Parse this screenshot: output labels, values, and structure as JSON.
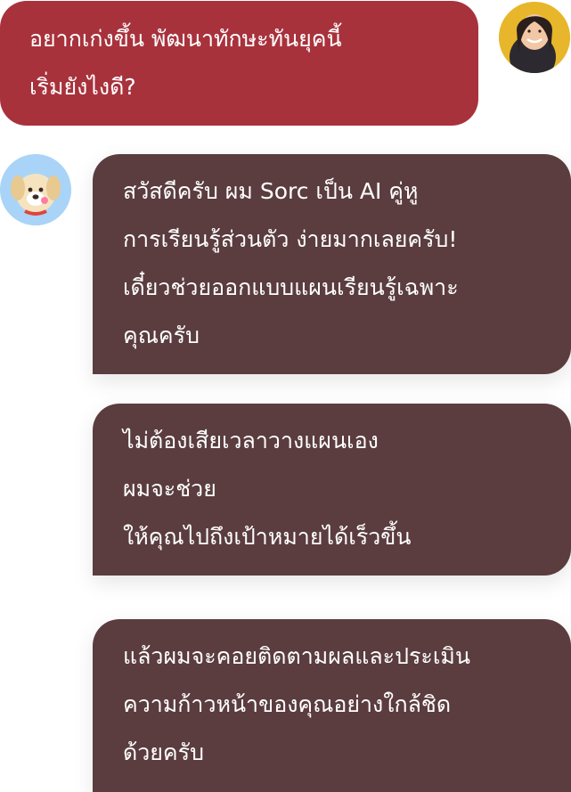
{
  "chat": {
    "user_message": "อยากเก่งขึ้น พัฒนาทักษะทันยุคนี้\nเริ่มยังไงดี?",
    "bot_messages": [
      "สวัสดีครับ ผม Sorc เป็น AI คู่หู\nการเรียนรู้ส่วนตัว ง่ายมากเลยครับ!\nเดี๋ยวช่วยออกแบบแผนเรียนรู้เฉพาะ\nคุณครับ",
      "ไม่ต้องเสียเวลาวางแผนเอง\nผมจะช่วย\nให้คุณไปถึงเป้าหมายได้เร็วขึ้น",
      "แล้วผมจะคอยติดตามผลและประเมิน\nความก้าวหน้าของคุณอย่างใกล้ชิด\nด้วยครับ"
    ]
  },
  "avatars": {
    "user": "user-avatar-photo",
    "bot": "dog-mascot-icon"
  },
  "colors": {
    "user_bubble": "#a8323c",
    "bot_bubble": "#5b3d3f",
    "text": "#ffffff"
  }
}
